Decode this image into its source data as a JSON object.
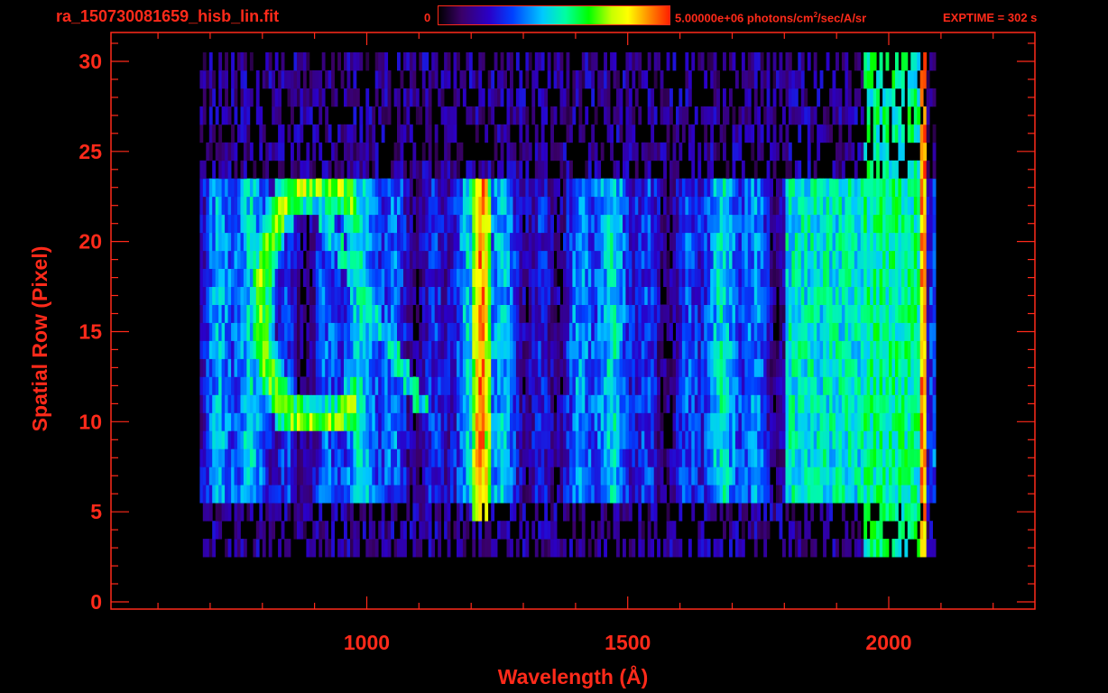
{
  "header": {
    "filename": "ra_150730081659_hisb_lin.fit",
    "colorbar_min": "0",
    "colorbar_max_prefix": "5.00000e+06 photons/cm",
    "colorbar_max_sup": "2",
    "colorbar_max_suffix": "/sec/A/sr",
    "exptime": "EXPTIME = 302 s"
  },
  "colors": {
    "axis": "#ff2a1a",
    "background": "#000000"
  },
  "chart_data": {
    "type": "heatmap",
    "title": "ra_150730081659_hisb_lin.fit",
    "xlabel": "Wavelength (Å)",
    "ylabel": "Spatial Row (Pixel)",
    "xlim": [
      510,
      2280
    ],
    "ylim": [
      -0.4,
      31.6
    ],
    "xticks": [
      1000,
      1500,
      2000
    ],
    "yticks": [
      0,
      5,
      10,
      15,
      20,
      25,
      30
    ],
    "x_minor_step": 100,
    "y_minor_step": 1,
    "colorbar": {
      "min": 0,
      "max": 5000000,
      "units": "photons/cm^2/sec/A/sr",
      "scale": "linear"
    },
    "data_extent": {
      "x_start": 680,
      "x_end": 2090,
      "y_start": 3,
      "y_end": 30
    },
    "features": [
      {
        "name": "Lyman-alpha emission line",
        "wavelength": 1216,
        "rows": [
          5,
          23
        ],
        "peak_level": 0.95
      },
      {
        "name": "bright edge emission",
        "wavelength": 2065,
        "rows": [
          3,
          30
        ],
        "peak_level": 0.9
      },
      {
        "name": "extended arc emission",
        "wavelength_range": [
          780,
          900
        ],
        "rows": [
          10,
          23
        ],
        "peak_level": 0.75
      },
      {
        "name": "diffuse continuum",
        "wavelength_range": [
          1800,
          2060
        ],
        "rows": [
          6,
          23
        ],
        "peak_level": 0.5
      }
    ]
  }
}
